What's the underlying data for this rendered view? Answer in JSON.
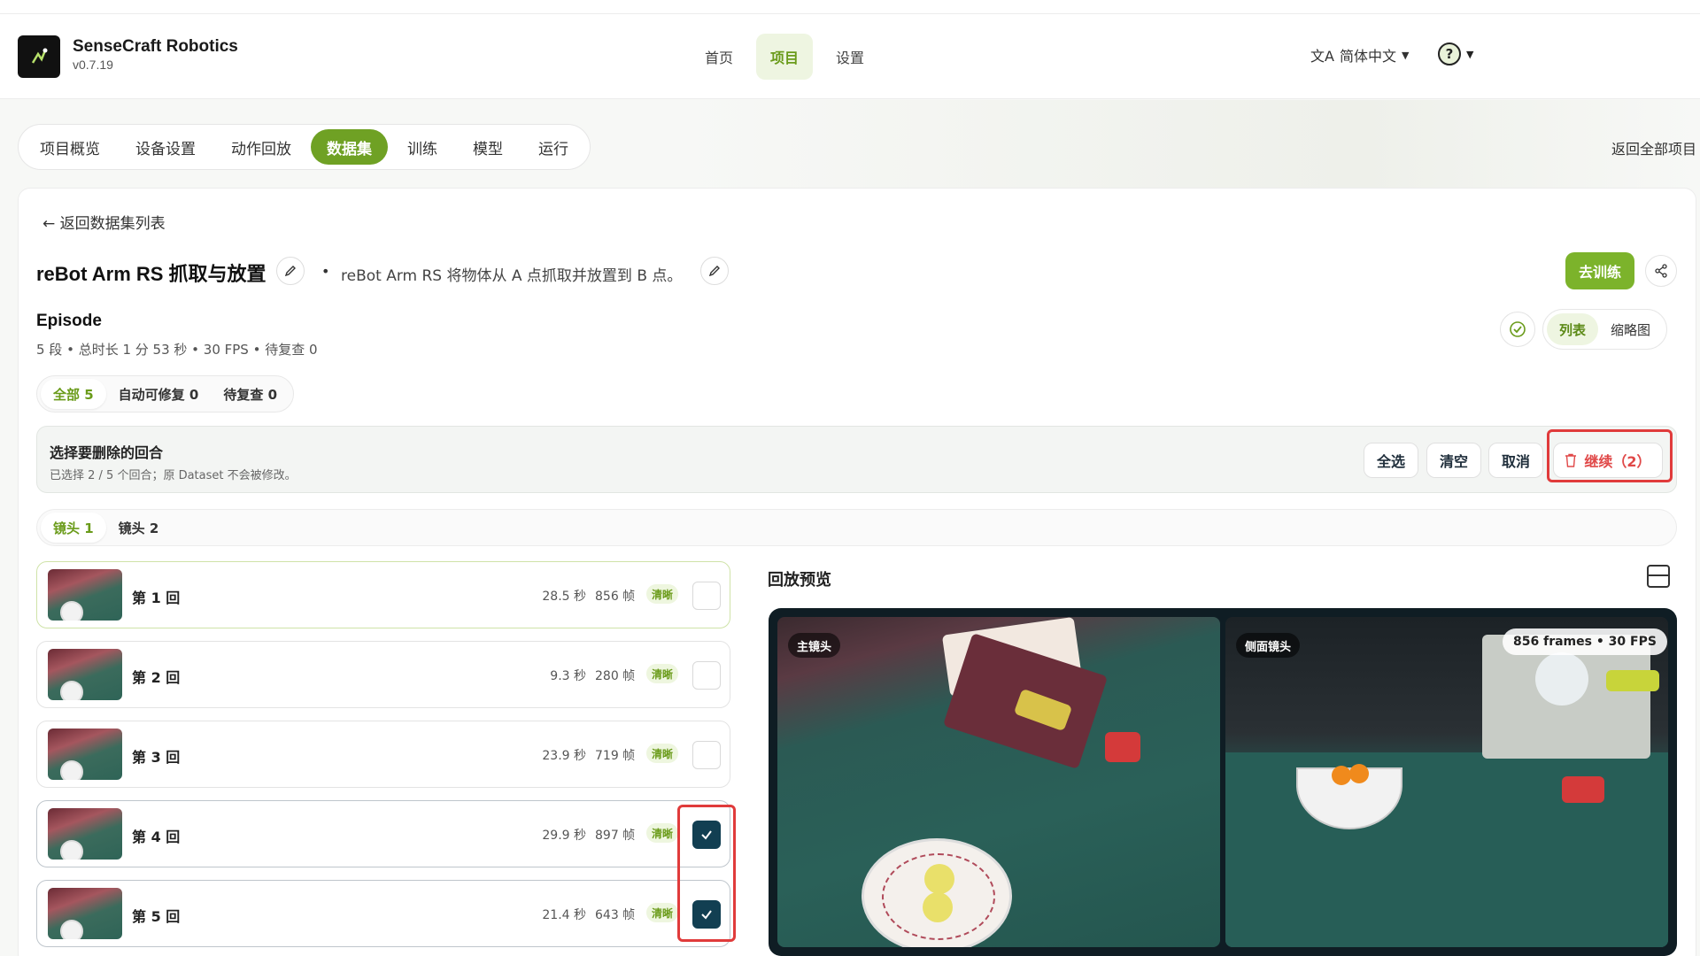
{
  "app": {
    "name": "SenseCraft Robotics",
    "version": "v0.7.19"
  },
  "topnav": {
    "items": [
      "首页",
      "项目",
      "设置"
    ],
    "active": 1
  },
  "lang": {
    "label": "简体中文"
  },
  "subnav": {
    "items": [
      "项目概览",
      "设备设置",
      "动作回放",
      "数据集",
      "训练",
      "模型",
      "运行"
    ],
    "active": 3
  },
  "back_all": "返回全部项目",
  "back_list": "← 返回数据集列表",
  "dataset": {
    "title": "reBot Arm RS 抓取与放置",
    "separator": "•",
    "description": "reBot Arm RS 将物体从 A 点抓取并放置到 B 点。",
    "train_label": "去训练"
  },
  "episode": {
    "heading": "Episode",
    "meta": "5 段 • 总时长 1 分 53 秒 • 30 FPS • 待复查 0",
    "view_modes": [
      "列表",
      "缩略图"
    ]
  },
  "filters": [
    "全部 5",
    "自动可修复 0",
    "待复查 0"
  ],
  "delete_bar": {
    "title": "选择要删除的回合",
    "subtitle": "已选择 2 / 5 个回合；原 Dataset 不会被修改。",
    "select_all": "全选",
    "clear": "清空",
    "cancel": "取消",
    "continue": "继续（2）"
  },
  "camera_tabs": [
    "镜头 1",
    "镜头 2"
  ],
  "episodes": [
    {
      "name": "第 1 回",
      "duration": "28.5 秒",
      "frames": "856 帧",
      "badge": "清晰",
      "checked": false
    },
    {
      "name": "第 2 回",
      "duration": "9.3 秒",
      "frames": "280 帧",
      "badge": "清晰",
      "checked": false
    },
    {
      "name": "第 3 回",
      "duration": "23.9 秒",
      "frames": "719 帧",
      "badge": "清晰",
      "checked": false
    },
    {
      "name": "第 4 回",
      "duration": "29.9 秒",
      "frames": "897 帧",
      "badge": "清晰",
      "checked": true
    },
    {
      "name": "第 5 回",
      "duration": "21.4 秒",
      "frames": "643 帧",
      "badge": "清晰",
      "checked": true
    }
  ],
  "preview": {
    "heading": "回放预览",
    "cam_main": "主镜头",
    "cam_side": "侧面镜头",
    "fps_label": "856 frames • 30 FPS"
  },
  "colors": {
    "accent": "#6fa124",
    "checkbox": "#123f52",
    "highlight": "#e03b3b"
  }
}
